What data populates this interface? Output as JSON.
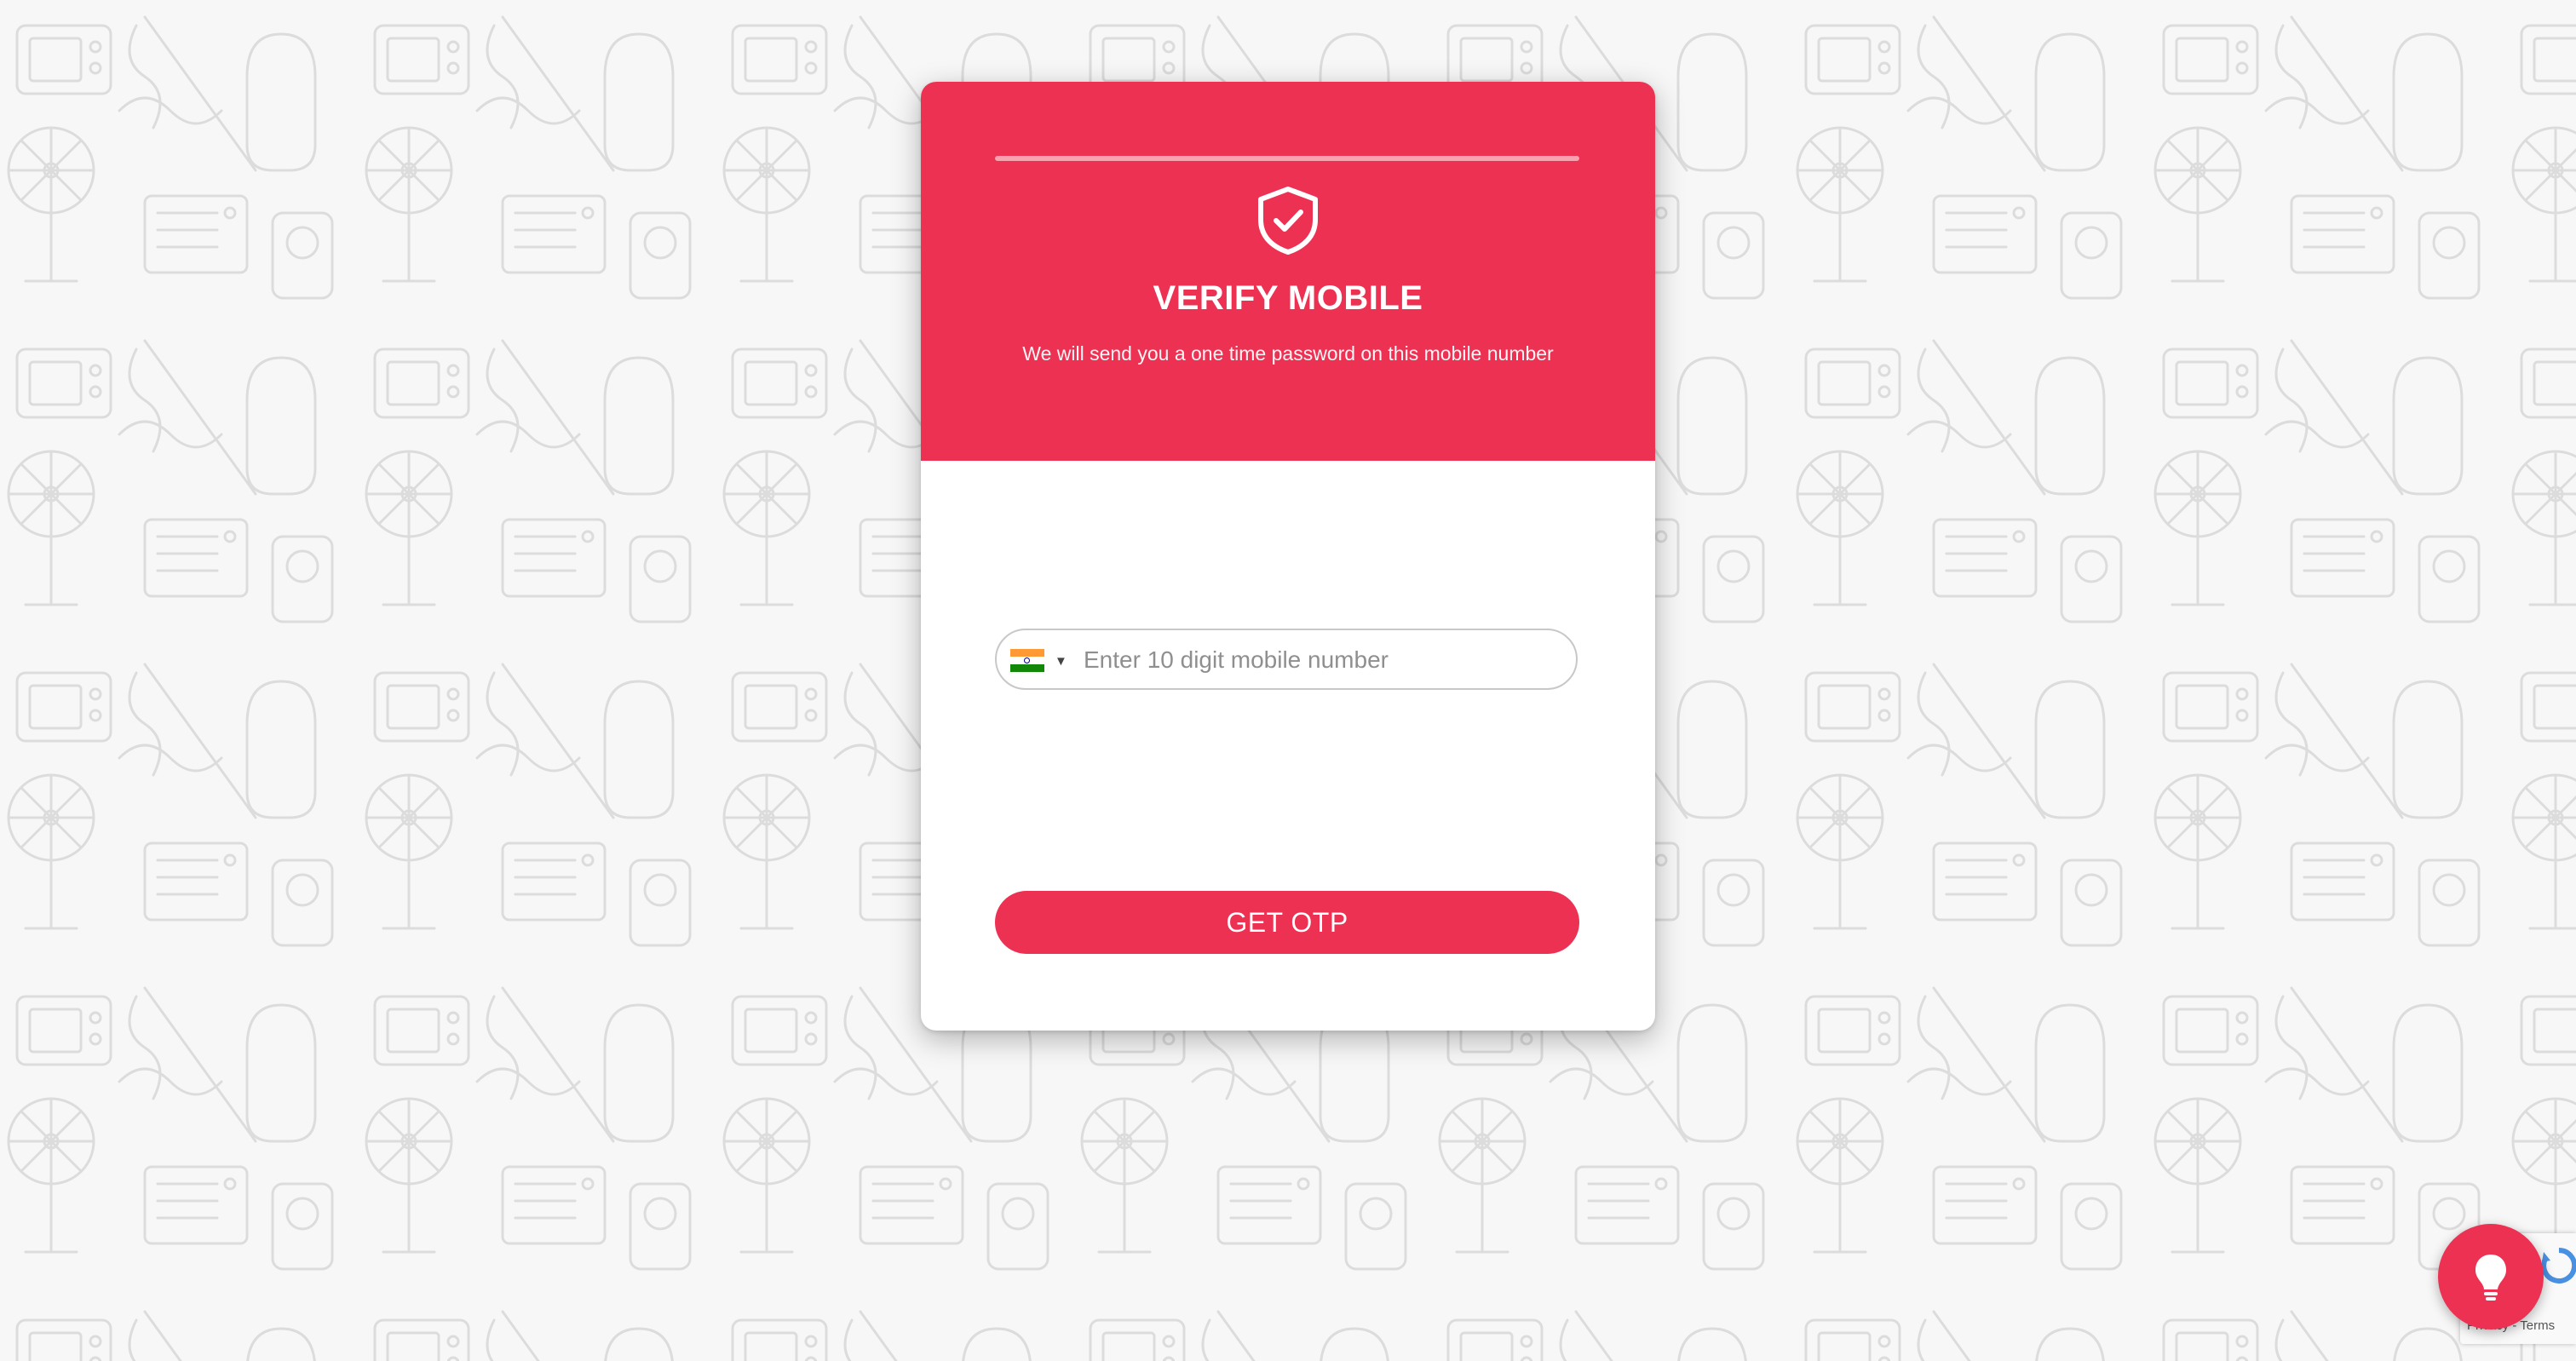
{
  "background": {
    "pattern_icon": "home-appliances-doodle-pattern"
  },
  "verify_card": {
    "title": "VERIFY MOBILE",
    "subtitle": "We will send you a one time password on this mobile number",
    "header_icon": "shield-check-icon",
    "accent_color": "#ed3152",
    "progress": 0
  },
  "phone_form": {
    "country_flag": "india-flag-icon",
    "placeholder": "Enter 10 digit mobile number",
    "value": "",
    "submit_label": "GET OTP"
  },
  "recaptcha": {
    "links": "Privacy - Terms"
  },
  "help_fab": {
    "icon": "lightbulb-icon"
  }
}
